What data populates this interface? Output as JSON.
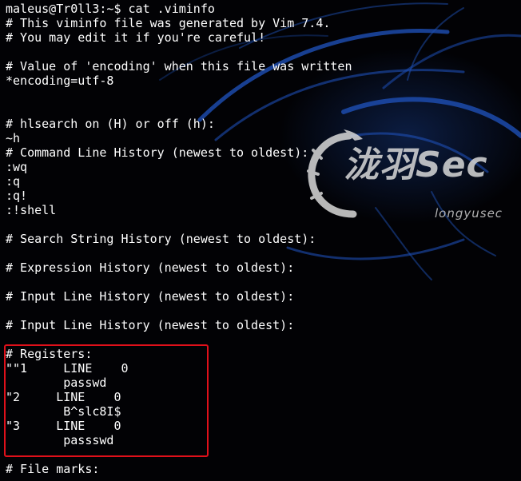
{
  "terminal": {
    "lines": [
      "maleus@Tr0ll3:~$ cat .viminfo",
      "# This viminfo file was generated by Vim 7.4.",
      "# You may edit it if you're careful!",
      "",
      "# Value of 'encoding' when this file was written",
      "*encoding=utf-8",
      "",
      "",
      "# hlsearch on (H) or off (h):",
      "~h",
      "# Command Line History (newest to oldest):",
      ":wq",
      ":q",
      ":q!",
      ":!shell",
      "",
      "# Search String History (newest to oldest):",
      "",
      "# Expression History (newest to oldest):",
      "",
      "# Input Line History (newest to oldest):",
      "",
      "# Input Line History (newest to oldest):",
      "",
      "# Registers:",
      "\"\"1     LINE    0",
      "        passwd",
      "\"2     LINE    0",
      "        B^slc8I$",
      "\"3     LINE    0",
      "        passswd",
      "",
      "# File marks:"
    ]
  },
  "watermark": {
    "title": "泷羽Sec",
    "subtitle": "longyusec"
  },
  "colors": {
    "background": "#020205",
    "text": "#ffffff",
    "highlight_border": "#e0101a",
    "art_blue": "#1e4fb4"
  }
}
